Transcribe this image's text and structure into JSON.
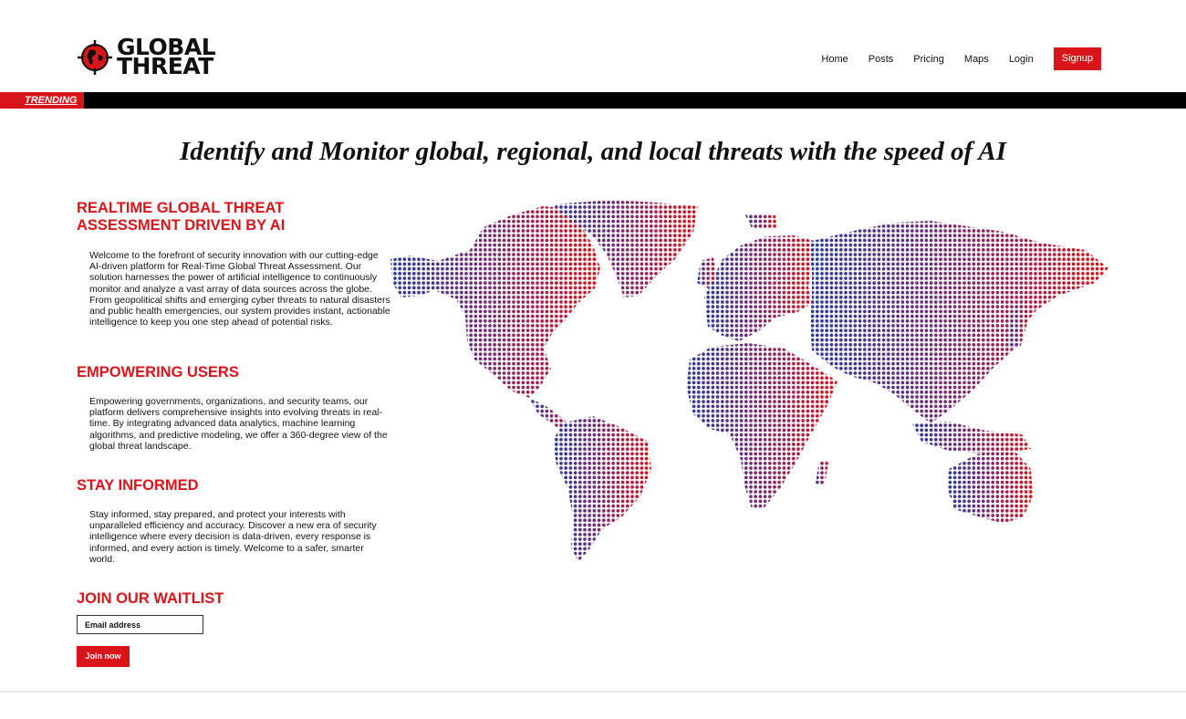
{
  "brand": {
    "line1": "GLOBAL",
    "line2": "THREAT"
  },
  "nav": {
    "items": [
      "Home",
      "Posts",
      "Pricing",
      "Maps",
      "Login"
    ],
    "signup": "Signup"
  },
  "trending": {
    "label": "TRENDING"
  },
  "hero": {
    "title": "Identify and Monitor global, regional, and local threats with the speed of AI"
  },
  "sections": [
    {
      "title": "REALTIME GLOBAL THREAT ASSESSMENT DRIVEN BY AI",
      "body": "Welcome to the forefront of security innovation with our cutting-edge AI-driven platform for Real-Time Global Threat Assessment. Our solution harnesses the power of artificial intelligence to continuously monitor and analyze a vast array of data sources across the globe. From geopolitical shifts and emerging cyber threats to natural disasters and public health emergencies, our system provides instant, actionable intelligence to keep you one step ahead of potential risks."
    },
    {
      "title": "EMPOWERING USERS",
      "body": "Empowering governments, organizations, and security teams, our platform delivers comprehensive insights into evolving threats in real-time. By integrating advanced data analytics, machine learning algorithms, and predictive modeling, we offer a 360-degree view of the global threat landscape."
    },
    {
      "title": "STAY INFORMED",
      "body": "Stay informed, stay prepared, and protect your interests with unparalleled efficiency and accuracy. Discover a new era of security intelligence where every decision is data-driven, every response is informed, and every action is timely. Welcome to a safer, smarter world."
    }
  ],
  "waitlist": {
    "title": "JOIN OUR WAITLIST",
    "placeholder": "Email address",
    "button": "Join now"
  },
  "colors": {
    "accent": "#d9141b",
    "map_west": "#2b3a9a",
    "map_east": "#d9141b"
  },
  "icons": {
    "logo": "crosshair-globe-icon"
  }
}
